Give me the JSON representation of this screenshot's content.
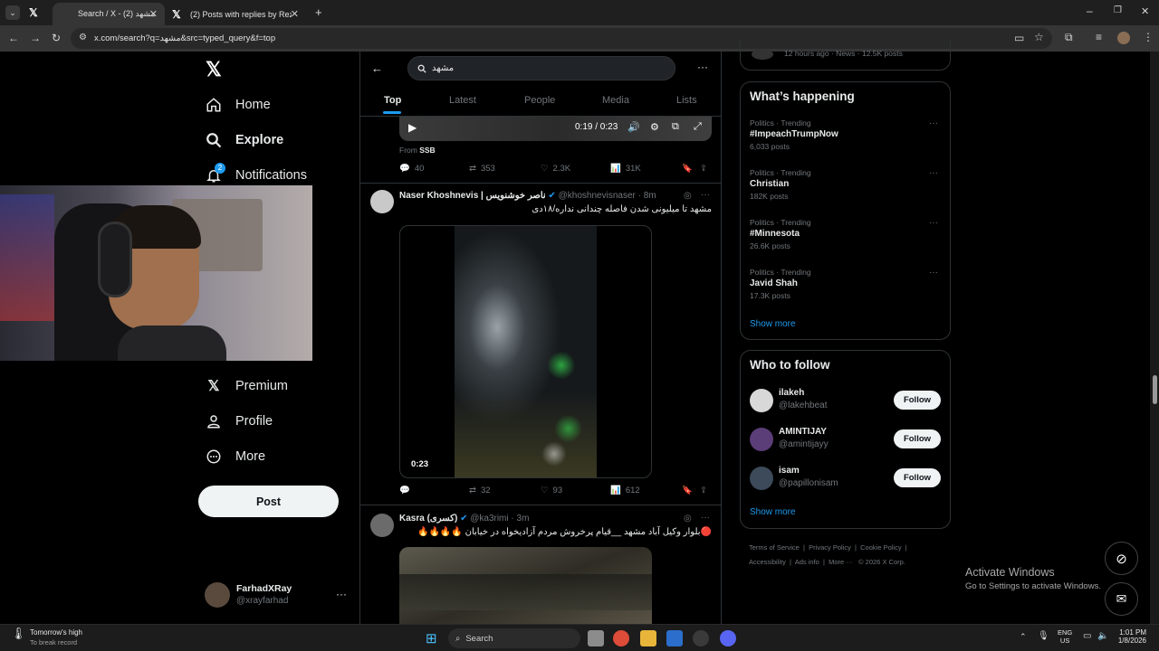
{
  "browser": {
    "tabs": [
      {
        "label": "Search / X - مشهد (2)",
        "active": true
      },
      {
        "label": "(2) Posts with replies by Reza P...",
        "active": false
      }
    ],
    "url": "x.com/search?q=مشهد&src=typed_query&f=top"
  },
  "nav": {
    "items": [
      "Home",
      "Explore",
      "Notifications",
      "Premium",
      "Profile",
      "More"
    ],
    "notifications_badge": "2",
    "post_label": "Post",
    "account": {
      "name": "FarhadXRay",
      "handle": "@xrayfarhad"
    }
  },
  "search": {
    "query": "مشهد",
    "tabs": [
      "Top",
      "Latest",
      "People",
      "Media",
      "Lists"
    ],
    "active_tab": "Top"
  },
  "tweets": [
    {
      "video_time": "0:19 / 0:23",
      "source": "From",
      "source_name": "SSB",
      "replies": "40",
      "reposts": "353",
      "likes": "2.3K",
      "views": "31K"
    },
    {
      "name": "Naser Khoshnevis | ناصر خوشنویس",
      "handle": "@khoshnevisnaser",
      "time": "· 8m",
      "text": "مشهد تا میلیونی شدن فاصله چندانی نداره/۱۸دی",
      "video_duration": "0:23",
      "replies": "",
      "reposts": "32",
      "likes": "93",
      "views": "612"
    },
    {
      "name": "Kasra (کسری)",
      "handle": "@ka3rimi",
      "time": "· 3m",
      "text": "🔴بلوار وکیل آباد مشهد __قیام پرخروش مردم آزادیخواه در خیابان 🔥🔥🔥🔥"
    }
  ],
  "sidebar": {
    "top_meta": "12 hours ago · News · 12.5K posts",
    "whats_happening": {
      "title": "What’s happening",
      "trends": [
        {
          "meta": "Politics · Trending",
          "title": "#ImpeachTrumpNow",
          "count": "6,033 posts"
        },
        {
          "meta": "Politics · Trending",
          "title": "Christian",
          "count": "182K posts"
        },
        {
          "meta": "Politics · Trending",
          "title": "#Minnesota",
          "count": "26.6K posts"
        },
        {
          "meta": "Politics · Trending",
          "title": "Javid Shah",
          "count": "17.3K posts"
        }
      ],
      "show_more": "Show more"
    },
    "who_to_follow": {
      "title": "Who to follow",
      "users": [
        {
          "name": "ilakeh",
          "handle": "@lakehbeat",
          "button": "Follow"
        },
        {
          "name": "AMINTIJAY",
          "handle": "@amintijayy",
          "button": "Follow"
        },
        {
          "name": "isam",
          "handle": "@papillonisam",
          "button": "Follow"
        }
      ],
      "show_more": "Show more"
    },
    "footer": [
      "Terms of Service",
      "Privacy Policy",
      "Cookie Policy",
      "Accessibility",
      "Ads info",
      "More ···",
      "© 2026 X Corp."
    ]
  },
  "watermark": {
    "line1": "Activate Windows",
    "line2": "Go to Settings to activate Windows."
  },
  "taskbar": {
    "weather_title": "Tomorrow's high",
    "weather_sub": "To break record",
    "search": "Search",
    "lang1": "ENG",
    "lang2": "US",
    "time": "1:01 PM",
    "date": "1/8/2026"
  }
}
